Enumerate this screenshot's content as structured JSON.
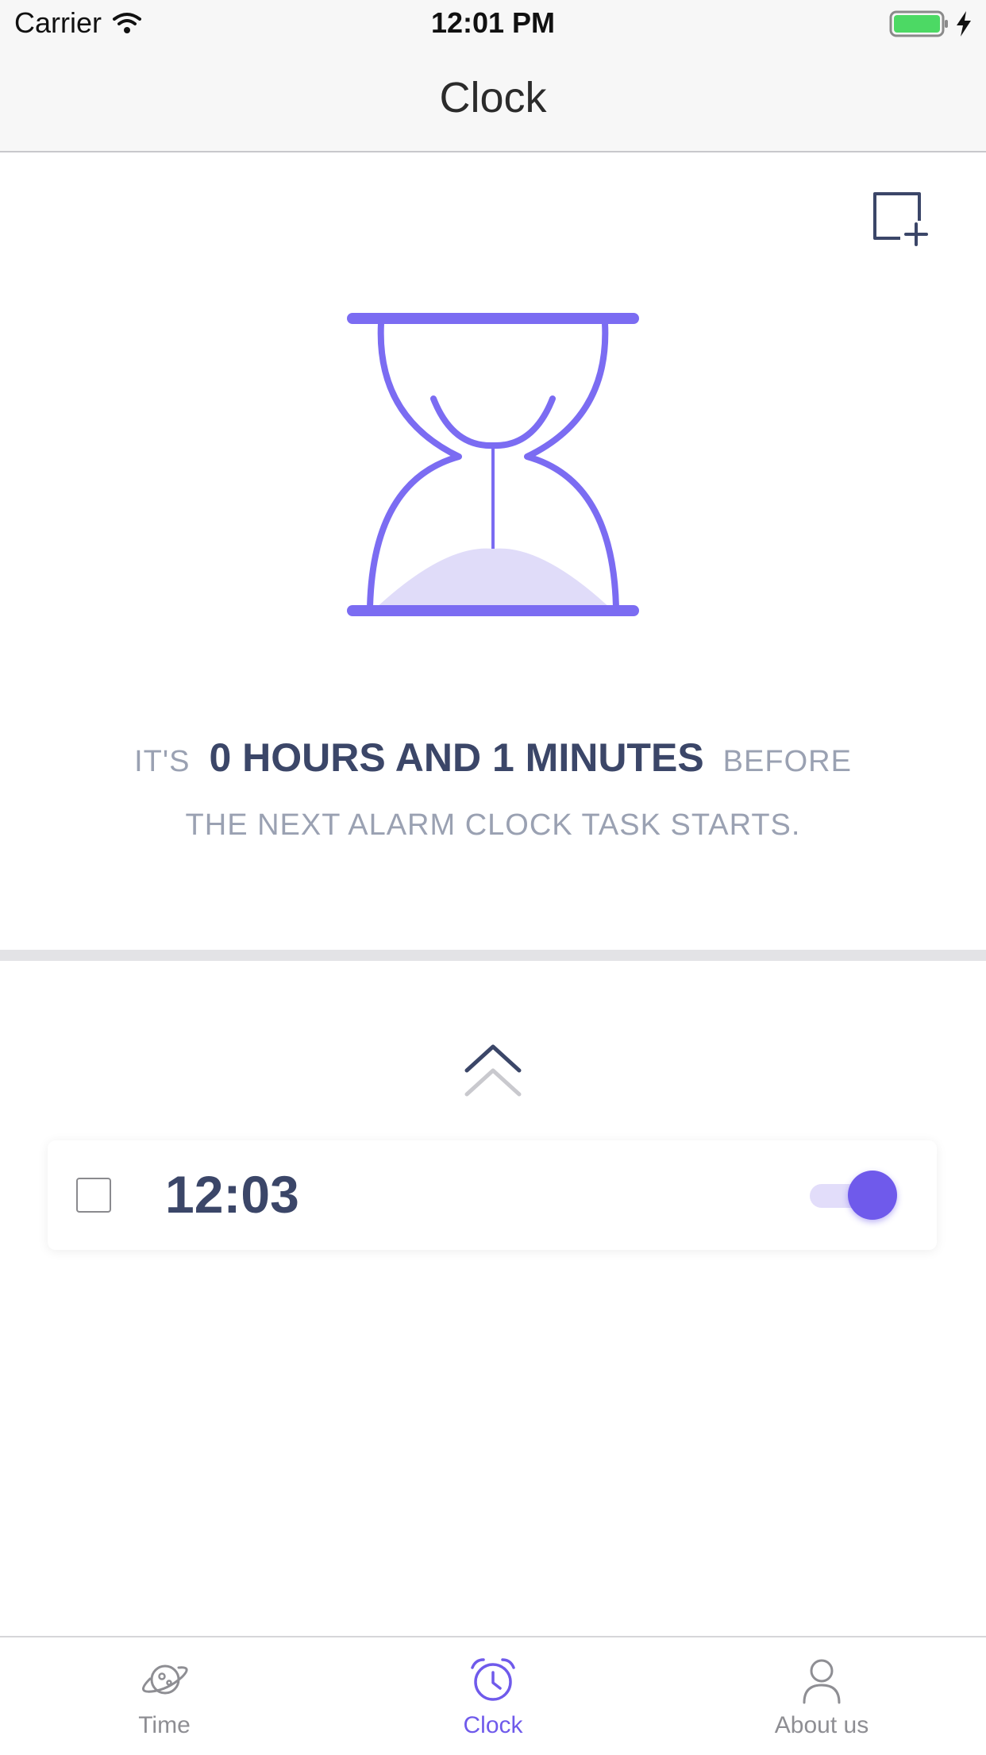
{
  "status_bar": {
    "carrier": "Carrier",
    "time": "12:01 PM",
    "battery_color": "#4cd964"
  },
  "nav": {
    "title": "Clock"
  },
  "toolbar": {
    "add_icon": "add-square-icon"
  },
  "hourglass": {
    "stroke_color": "#7b6cf2",
    "sand_color": "#e0dcf9"
  },
  "countdown": {
    "prefix": "IT'S",
    "value": "0 HOURS AND 1 MINUTES",
    "suffix": "BEFORE",
    "line2": "THE NEXT ALARM CLOCK TASK STARTS."
  },
  "alarms": [
    {
      "time": "12:03",
      "checked": false,
      "enabled": true
    }
  ],
  "colors": {
    "accent": "#6f5aeb",
    "heading": "#3b4668",
    "muted": "#9aa1b2",
    "tab_inactive": "#8e8e93"
  },
  "tabs": [
    {
      "label": "Time",
      "icon": "planet-icon",
      "active": false
    },
    {
      "label": "Clock",
      "icon": "alarm-clock-icon",
      "active": true
    },
    {
      "label": "About us",
      "icon": "person-icon",
      "active": false
    }
  ]
}
